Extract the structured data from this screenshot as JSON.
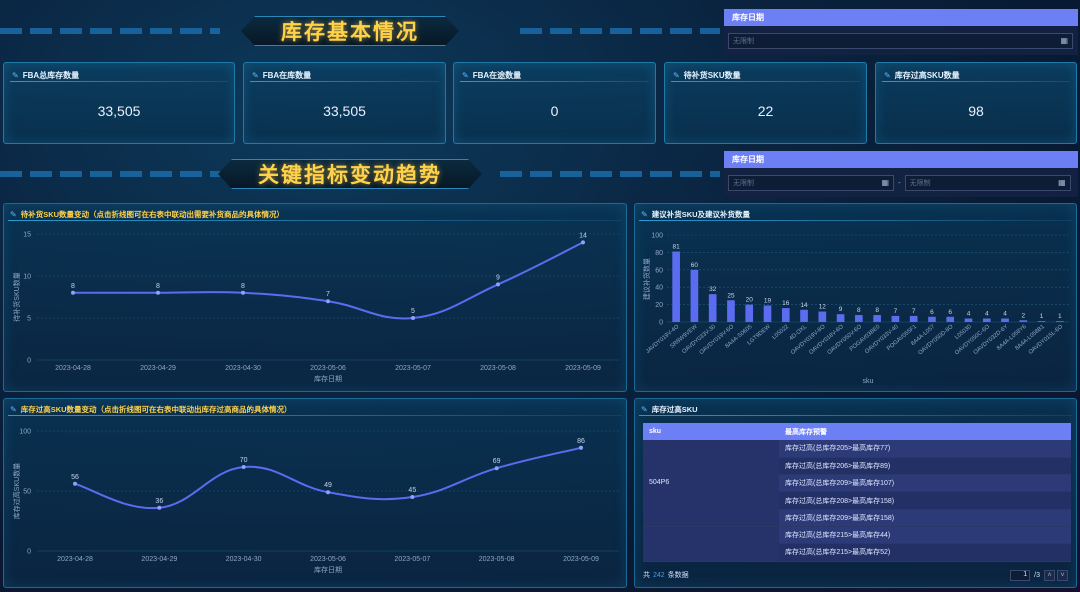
{
  "section1": {
    "title": "库存基本情况"
  },
  "section2": {
    "title": "关键指标变动趋势"
  },
  "filter1": {
    "label": "库存日期",
    "placeholder": "无限制"
  },
  "filter2": {
    "label": "库存日期",
    "start_placeholder": "无限制",
    "separator": "-",
    "end_placeholder": "无限制"
  },
  "kpis": [
    {
      "title": "FBA总库存数量",
      "value": "33,505"
    },
    {
      "title": "FBA在库数量",
      "value": "33,505"
    },
    {
      "title": "FBA在途数量",
      "value": "0"
    },
    {
      "title": "待补货SKU数量",
      "value": "22"
    },
    {
      "title": "库存过高SKU数量",
      "value": "98"
    }
  ],
  "colors": {
    "accent": "#6d7ff5",
    "gold": "#ffd24a",
    "line": "#5b6cf0",
    "bar": "#5b6cf0"
  },
  "chart_data": [
    {
      "type": "line",
      "title": "待补货SKU数量变动（点击折线图可在右表中联动出需要补货商品的具体情况）",
      "x": [
        "2023-04-28",
        "2023-04-29",
        "2023-04-30",
        "2023-05-06",
        "2023-05-07",
        "2023-05-08",
        "2023-05-09"
      ],
      "values": [
        8,
        8,
        8,
        7,
        5,
        9,
        14
      ],
      "xlabel": "库存日期",
      "ylabel": "待补货SKU数量",
      "yticks": [
        0,
        5,
        10,
        15
      ],
      "ylim": [
        0,
        15
      ]
    },
    {
      "type": "bar",
      "title": "建议补货SKU及建议补货数量",
      "categories": [
        "JAVDY019V-4O",
        "SR8W9VEW",
        "OAVDY033V-30",
        "OAVDY019V-6O",
        "8A4A-S0605",
        "LGT9DEW",
        "L05022",
        "4D-OXL",
        "OAVDY019V-8O",
        "OAVDY018V-6O",
        "OAVDY050V-6O",
        "POGAV03BE0",
        "OAVDY033V-40",
        "POGAV055F1",
        "8A4A-L057",
        "OAVDY050D-8O",
        "L05030",
        "OAVDY050C-6O",
        "OAVDY032D-6Y",
        "8A4A-L058Y6",
        "8A4A-L058B1",
        "OAVDY015L-6O"
      ],
      "values": [
        81,
        60,
        32,
        25,
        20,
        19,
        16,
        14,
        12,
        9,
        8,
        8,
        7,
        7,
        6,
        6,
        4,
        4,
        4,
        2,
        1,
        1
      ],
      "xlabel": "sku",
      "ylabel": "建议补货数量",
      "yticks": [
        0,
        20,
        40,
        60,
        80,
        100
      ],
      "ylim": [
        0,
        100
      ]
    },
    {
      "type": "line",
      "title": "库存过高SKU数量变动（点击折线图可在右表中联动出库存过高商品的具体情况）",
      "x": [
        "2023-04-28",
        "2023-04-29",
        "2023-04-30",
        "2023-05-06",
        "2023-05-07",
        "2023-05-08",
        "2023-05-09"
      ],
      "values": [
        56,
        36,
        70,
        49,
        45,
        69,
        86
      ],
      "xlabel": "库存日期",
      "ylabel": "库存过高SKU数量",
      "yticks": [
        0,
        50,
        100
      ],
      "ylim": [
        0,
        100
      ]
    }
  ],
  "table": {
    "title": "库存过高SKU",
    "headers": [
      "sku",
      "最高库存预警"
    ],
    "group1_sku": "504P6",
    "group1_rows": [
      "库存过高(总库存205>最高库存77)",
      "库存过高(总库存206>最高库存89)",
      "库存过高(总库存209>最高库存107)",
      "库存过高(总库存208>最高库存158)",
      "库存过高(总库存209>最高库存158)"
    ],
    "group2_rows": [
      "库存过高(总库存215>最高库存44)",
      "库存过高(总库存215>最高库存52)"
    ]
  },
  "pager": {
    "prefix": "共",
    "total": "242",
    "suffix": "条数据",
    "page": "1",
    "pages": "/3"
  }
}
